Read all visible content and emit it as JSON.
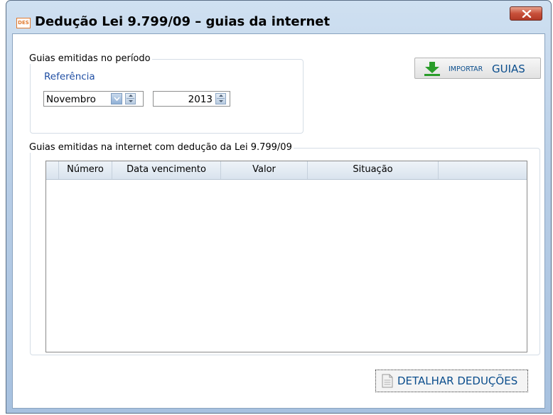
{
  "window": {
    "app_icon_text": "DES",
    "title": "Dedução Lei 9.799/09 – guias da internet"
  },
  "period_group": {
    "label": "Guias emitidas no período",
    "reference_label": "Referência",
    "month_value": "Novembro",
    "year_value": "2013"
  },
  "import_button": {
    "small_label": "IMPORTAR",
    "big_label": "GUIAS"
  },
  "guides_group": {
    "label": "Guias emitidas na internet com dedução da Lei 9.799/09",
    "columns": [
      "Número",
      "Data vencimento",
      "Valor",
      "Situação"
    ],
    "rows": []
  },
  "detail_button": {
    "label": "DETALHAR DEDUÇÕES"
  },
  "colors": {
    "accent_blue": "#0a4d8c",
    "reference_blue": "#1f4ea3",
    "close_red": "#c8503a",
    "import_icon_green": "#2a9d2a"
  }
}
